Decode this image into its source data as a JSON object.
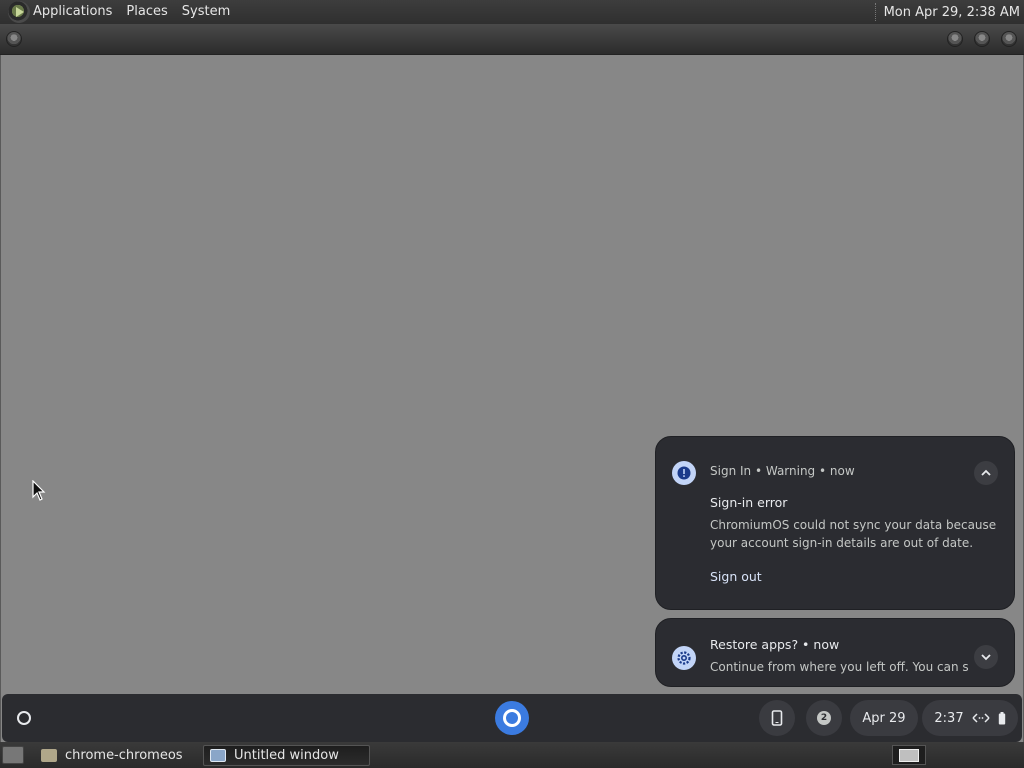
{
  "top_panel": {
    "menus": [
      "Applications",
      "Places",
      "System"
    ],
    "clock": "Mon Apr 29, 2:38 AM"
  },
  "notifications": {
    "signin": {
      "header": "Sign In • Warning • now",
      "title": "Sign-in error",
      "body": "ChromiumOS could not sync your data because your account sign-in details are out of date.",
      "action": "Sign out",
      "icon": "alert-icon"
    },
    "restore": {
      "header": "Restore apps? • now",
      "body": "Continue from where you left off. You can s…",
      "icon": "settings-icon"
    }
  },
  "shelf": {
    "notification_count": "2",
    "date": "Apr 29",
    "time": "2:37"
  },
  "taskbar": {
    "tasks": [
      "chrome-chromeos",
      "Untitled window"
    ]
  },
  "colors": {
    "desktop": "#878787",
    "notification_bg": "#2b2c31",
    "accent": "#3b7be0"
  }
}
